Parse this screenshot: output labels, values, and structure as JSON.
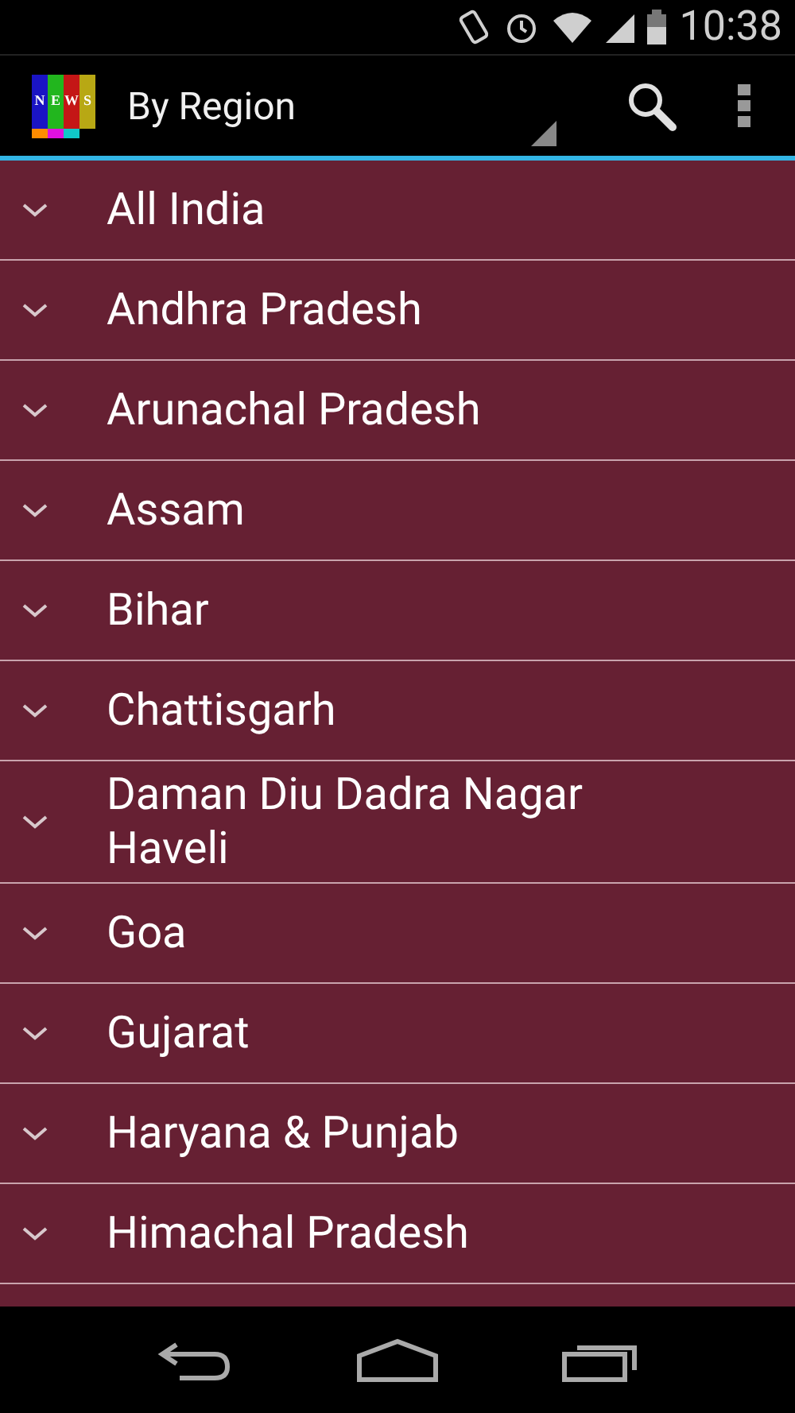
{
  "status_bar": {
    "time": "10:38"
  },
  "action_bar": {
    "logo_letters": [
      "N",
      "E",
      "W",
      "S"
    ],
    "title": "By Region"
  },
  "regions": [
    {
      "name": "All India",
      "expanded": false
    },
    {
      "name": "Andhra Pradesh",
      "expanded": false
    },
    {
      "name": "Arunachal Pradesh",
      "expanded": false
    },
    {
      "name": "Assam",
      "expanded": false
    },
    {
      "name": "Bihar",
      "expanded": false
    },
    {
      "name": "Chattisgarh",
      "expanded": false
    },
    {
      "name": "Daman Diu Dadra Nagar Haveli",
      "expanded": false
    },
    {
      "name": "Goa",
      "expanded": false
    },
    {
      "name": "Gujarat",
      "expanded": false
    },
    {
      "name": "Haryana & Punjab",
      "expanded": false
    },
    {
      "name": "Himachal Pradesh",
      "expanded": false
    }
  ]
}
